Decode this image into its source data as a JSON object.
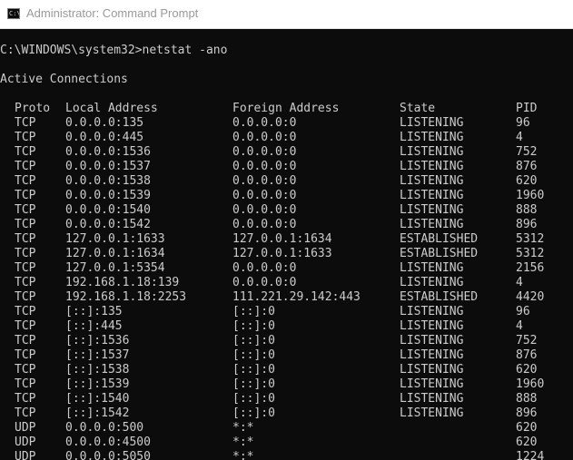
{
  "window": {
    "title": "Administrator: Command Prompt",
    "icon": "console-icon",
    "icon_glyph": "C:\\"
  },
  "console": {
    "command_line": "C:\\WINDOWS\\system32>netstat -ano",
    "section_title": "Active Connections",
    "headers": [
      "Proto",
      "Local Address",
      "Foreign Address",
      "State",
      "PID"
    ],
    "rows": [
      [
        "TCP",
        "0.0.0.0:135",
        "0.0.0.0:0",
        "LISTENING",
        "96"
      ],
      [
        "TCP",
        "0.0.0.0:445",
        "0.0.0.0:0",
        "LISTENING",
        "4"
      ],
      [
        "TCP",
        "0.0.0.0:1536",
        "0.0.0.0:0",
        "LISTENING",
        "752"
      ],
      [
        "TCP",
        "0.0.0.0:1537",
        "0.0.0.0:0",
        "LISTENING",
        "876"
      ],
      [
        "TCP",
        "0.0.0.0:1538",
        "0.0.0.0:0",
        "LISTENING",
        "620"
      ],
      [
        "TCP",
        "0.0.0.0:1539",
        "0.0.0.0:0",
        "LISTENING",
        "1960"
      ],
      [
        "TCP",
        "0.0.0.0:1540",
        "0.0.0.0:0",
        "LISTENING",
        "888"
      ],
      [
        "TCP",
        "0.0.0.0:1542",
        "0.0.0.0:0",
        "LISTENING",
        "896"
      ],
      [
        "TCP",
        "127.0.0.1:1633",
        "127.0.0.1:1634",
        "ESTABLISHED",
        "5312"
      ],
      [
        "TCP",
        "127.0.0.1:1634",
        "127.0.0.1:1633",
        "ESTABLISHED",
        "5312"
      ],
      [
        "TCP",
        "127.0.0.1:5354",
        "0.0.0.0:0",
        "LISTENING",
        "2156"
      ],
      [
        "TCP",
        "192.168.1.18:139",
        "0.0.0.0:0",
        "LISTENING",
        "4"
      ],
      [
        "TCP",
        "192.168.1.18:2253",
        "111.221.29.142:443",
        "ESTABLISHED",
        "4420"
      ],
      [
        "TCP",
        "[::]:135",
        "[::]:0",
        "LISTENING",
        "96"
      ],
      [
        "TCP",
        "[::]:445",
        "[::]:0",
        "LISTENING",
        "4"
      ],
      [
        "TCP",
        "[::]:1536",
        "[::]:0",
        "LISTENING",
        "752"
      ],
      [
        "TCP",
        "[::]:1537",
        "[::]:0",
        "LISTENING",
        "876"
      ],
      [
        "TCP",
        "[::]:1538",
        "[::]:0",
        "LISTENING",
        "620"
      ],
      [
        "TCP",
        "[::]:1539",
        "[::]:0",
        "LISTENING",
        "1960"
      ],
      [
        "TCP",
        "[::]:1540",
        "[::]:0",
        "LISTENING",
        "888"
      ],
      [
        "TCP",
        "[::]:1542",
        "[::]:0",
        "LISTENING",
        "896"
      ],
      [
        "UDP",
        "0.0.0.0:500",
        "*:*",
        "",
        "620"
      ],
      [
        "UDP",
        "0.0.0.0:4500",
        "*:*",
        "",
        "620"
      ],
      [
        "UDP",
        "0.0.0.0:5050",
        "*:*",
        "",
        "1224"
      ]
    ]
  },
  "colors": {
    "console_background": "#0c0c0c",
    "console_text": "#cccccc",
    "titlebar_background": "#ffffff",
    "title_text": "#9a9a9a"
  }
}
